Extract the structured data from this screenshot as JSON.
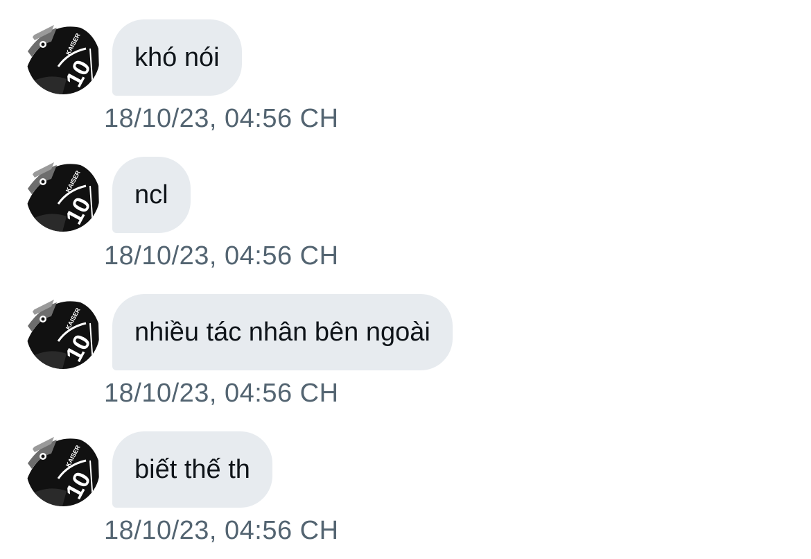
{
  "conversation": {
    "messages": [
      {
        "text": "khó nói",
        "timestamp": "18/10/23, 04:56 CH",
        "avatar": {
          "icon": "profile-avatar-icon",
          "jersey_name": "KAISER",
          "jersey_number": "10"
        }
      },
      {
        "text": "ncl",
        "timestamp": "18/10/23, 04:56 CH",
        "avatar": {
          "icon": "profile-avatar-icon",
          "jersey_name": "KAISER",
          "jersey_number": "10"
        }
      },
      {
        "text": "nhiều tác nhân bên ngoài",
        "timestamp": "18/10/23, 04:56 CH",
        "avatar": {
          "icon": "profile-avatar-icon",
          "jersey_name": "KAISER",
          "jersey_number": "10"
        }
      },
      {
        "text": "biết thế th",
        "timestamp": "18/10/23, 04:56 CH",
        "avatar": {
          "icon": "profile-avatar-icon",
          "jersey_name": "KAISER",
          "jersey_number": "10"
        }
      }
    ]
  },
  "colors": {
    "bubble_background": "#e7ebef",
    "message_text": "#0f1419",
    "timestamp_text": "#536471",
    "page_background": "#ffffff"
  }
}
